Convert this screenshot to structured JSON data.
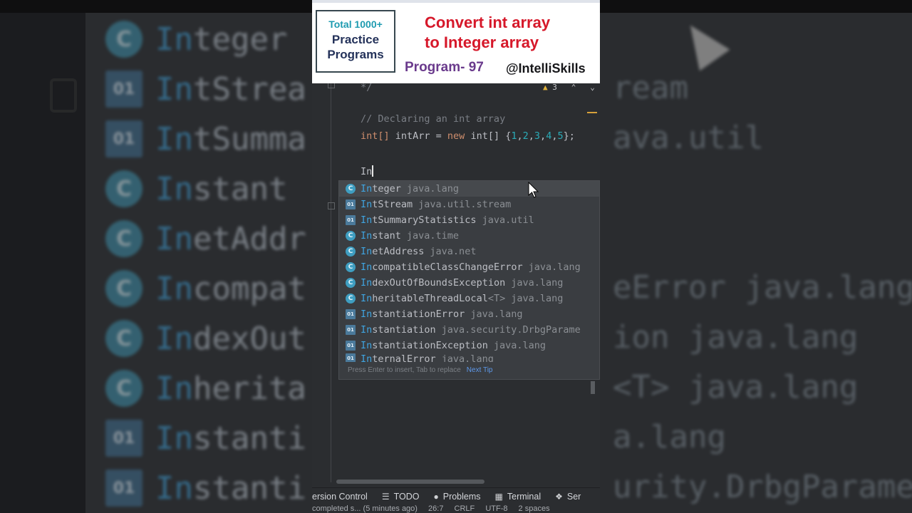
{
  "background": {
    "rows": [
      {
        "icon": "C",
        "type": "class",
        "match": "In",
        "rest": "teger",
        "pkg": ""
      },
      {
        "icon": "01",
        "type": "interface",
        "match": "In",
        "rest": "tStrea",
        "pkg": ""
      },
      {
        "icon": "01",
        "type": "interface",
        "match": "In",
        "rest": "tSumma",
        "pkg": ""
      },
      {
        "icon": "C",
        "type": "class",
        "match": "In",
        "rest": "stant",
        "pkg": ""
      },
      {
        "icon": "C",
        "type": "class",
        "match": "In",
        "rest": "etAddr",
        "pkg": ""
      },
      {
        "icon": "C",
        "type": "class",
        "match": "In",
        "rest": "compat",
        "pkg": ""
      },
      {
        "icon": "C",
        "type": "class",
        "match": "In",
        "rest": "dexOut",
        "pkg": ""
      },
      {
        "icon": "C",
        "type": "class",
        "match": "In",
        "rest": "herita",
        "pkg": ""
      },
      {
        "icon": "01",
        "type": "interface",
        "match": "In",
        "rest": "stanti",
        "pkg": ""
      },
      {
        "icon": "01",
        "type": "interface",
        "match": "In",
        "rest": "stanti",
        "pkg": ""
      }
    ],
    "right_fragments": [
      {
        "row": 1,
        "text": "ream"
      },
      {
        "row": 2,
        "text": "ava.util"
      },
      {
        "row": 5,
        "text": "eError java.lang"
      },
      {
        "row": 6,
        "text": "ion java.lang"
      },
      {
        "row": 7,
        "text": "<T> java.lang"
      },
      {
        "row": 8,
        "text": "a.lang"
      },
      {
        "row": 9,
        "text": "urity.DrbgParame"
      }
    ]
  },
  "banner": {
    "badge_top": "Total 1000+",
    "badge_mid": "Practice",
    "badge_bot": "Programs",
    "headline_1": "Convert int array",
    "headline_2": "to Integer array",
    "program": "Program- 97",
    "handle": "@IntelliSkills",
    "colors": {
      "headline": "#d6182a",
      "program": "#6a3a8c",
      "badge_top": "#1e9bb0"
    }
  },
  "editor": {
    "comment_end": "*/",
    "warning_count": "3",
    "comment": "// Declaring an int array",
    "decl_type": "int[]",
    "decl_var": " intArr = ",
    "decl_new": "new",
    "decl_type2": " int[] {",
    "decl_nums": [
      "1",
      "2",
      "3",
      "4",
      "5"
    ],
    "decl_end": "};",
    "typed": "In"
  },
  "completion": {
    "items": [
      {
        "icon": "C",
        "type": "class",
        "match": "In",
        "rest": "teger",
        "generic": "",
        "pkg": "java.lang",
        "selected": true
      },
      {
        "icon": "01",
        "type": "interface",
        "match": "In",
        "rest": "tStream",
        "generic": "",
        "pkg": "java.util.stream",
        "selected": false
      },
      {
        "icon": "01",
        "type": "interface",
        "match": "In",
        "rest": "tSummaryStatistics",
        "generic": "",
        "pkg": "java.util",
        "selected": false
      },
      {
        "icon": "C",
        "type": "class",
        "match": "In",
        "rest": "stant",
        "generic": "",
        "pkg": "java.time",
        "selected": false
      },
      {
        "icon": "C",
        "type": "class",
        "match": "In",
        "rest": "etAddress",
        "generic": "",
        "pkg": "java.net",
        "selected": false
      },
      {
        "icon": "C",
        "type": "class",
        "match": "In",
        "rest": "compatibleClassChangeError",
        "generic": "",
        "pkg": "java.lang",
        "selected": false
      },
      {
        "icon": "C",
        "type": "class",
        "match": "In",
        "rest": "dexOutOfBoundsException",
        "generic": "",
        "pkg": "java.lang",
        "selected": false
      },
      {
        "icon": "C",
        "type": "class",
        "match": "In",
        "rest": "heritableThreadLocal",
        "generic": "<T>",
        "pkg": "java.lang",
        "selected": false
      },
      {
        "icon": "01",
        "type": "interface",
        "match": "In",
        "rest": "stantiationError",
        "generic": "",
        "pkg": "java.lang",
        "selected": false
      },
      {
        "icon": "01",
        "type": "interface",
        "match": "In",
        "rest": "stantiation",
        "generic": "",
        "pkg": "java.security.DrbgParame",
        "selected": false
      },
      {
        "icon": "01",
        "type": "interface",
        "match": "In",
        "rest": "stantiationException",
        "generic": "",
        "pkg": "java.lang",
        "selected": false
      },
      {
        "icon": "01",
        "type": "interface",
        "match": "In",
        "rest": "ternalError",
        "generic": "",
        "pkg": "java.lang",
        "selected": false
      }
    ],
    "footer_text": "Press Enter to insert, Tab to replace",
    "footer_tip": "Next Tip"
  },
  "toolbar": {
    "version_control": "ersion Control",
    "todo": "TODO",
    "problems": "Problems",
    "terminal": "Terminal",
    "services": "Ser"
  },
  "status": {
    "message": "completed s... (5 minutes ago)",
    "position": "26:7",
    "line_sep": "CRLF",
    "encoding": "UTF-8",
    "indent": "2 spaces"
  }
}
